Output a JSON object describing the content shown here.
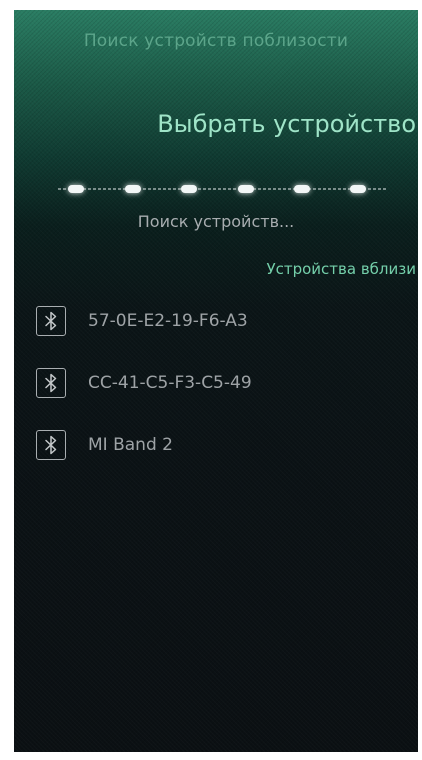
{
  "top_bar": {
    "title": "Поиск устройств поблизости"
  },
  "header": {
    "title": "Выбрать устройство"
  },
  "search": {
    "status": "Поиск устройств..."
  },
  "devices": {
    "section_label": "Устройства вблизи",
    "icon": "bluetooth-icon",
    "items": [
      {
        "label": "57-0E-E2-19-F6-A3"
      },
      {
        "label": "CC-41-C5-F3-C5-49"
      },
      {
        "label": "MI Band 2"
      }
    ]
  },
  "colors": {
    "accent": "#9fe4c8",
    "section_accent": "#74cfaa",
    "background_top": "#2a7d63",
    "background_bottom": "#0b1013",
    "text_secondary": "#9ea3a6"
  }
}
